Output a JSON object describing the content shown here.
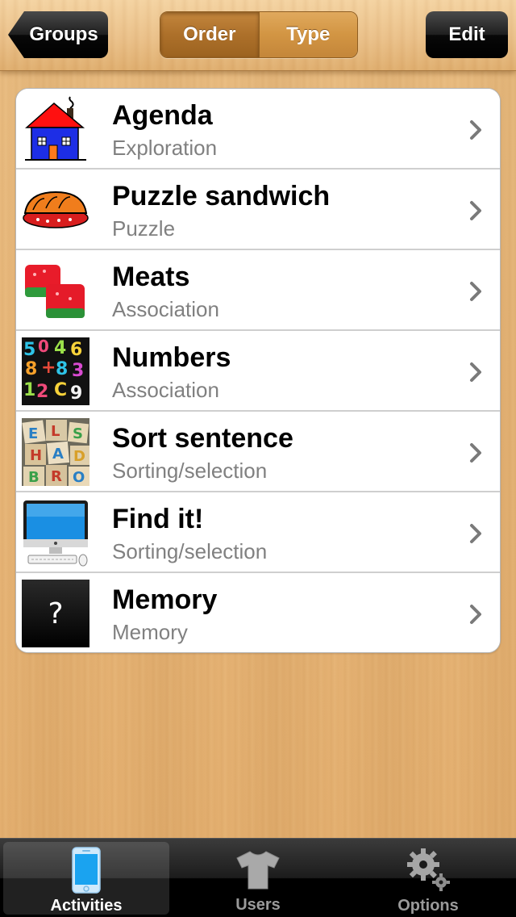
{
  "nav": {
    "back_label": "Groups",
    "segments": [
      {
        "label": "Order",
        "selected": true
      },
      {
        "label": "Type",
        "selected": false
      }
    ],
    "edit_label": "Edit"
  },
  "activities": [
    {
      "title": "Agenda",
      "subtitle": "Exploration",
      "icon": "house-icon"
    },
    {
      "title": "Puzzle sandwich",
      "subtitle": "Puzzle",
      "icon": "sandwich-icon"
    },
    {
      "title": "Meats",
      "subtitle": "Association",
      "icon": "candy-icon"
    },
    {
      "title": "Numbers",
      "subtitle": "Association",
      "icon": "numbers-icon"
    },
    {
      "title": "Sort sentence",
      "subtitle": "Sorting/selection",
      "icon": "letter-blocks-icon"
    },
    {
      "title": "Find it!",
      "subtitle": "Sorting/selection",
      "icon": "computer-icon"
    },
    {
      "title": "Memory",
      "subtitle": "Memory",
      "icon": "question-mark-icon",
      "icon_text": "?"
    }
  ],
  "tabbar": {
    "tabs": [
      {
        "label": "Activities",
        "icon": "phone-icon",
        "active": true
      },
      {
        "label": "Users",
        "icon": "tshirt-icon",
        "active": false
      },
      {
        "label": "Options",
        "icon": "gears-icon",
        "active": false
      }
    ]
  },
  "colors": {
    "accent_selected": "#ad702a",
    "subtitle_gray": "#808080",
    "wood": "#e7b679"
  }
}
